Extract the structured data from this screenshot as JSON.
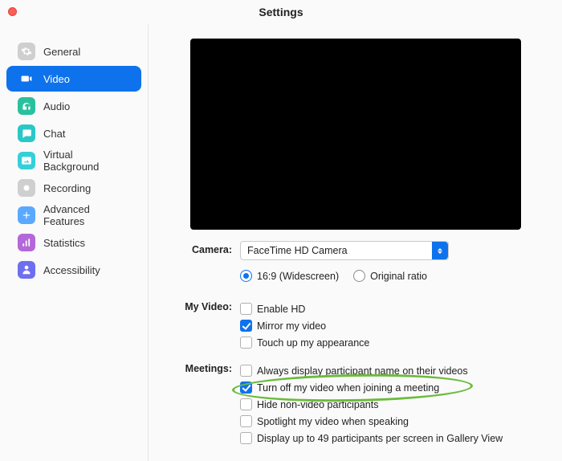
{
  "window": {
    "title": "Settings"
  },
  "sidebar": {
    "items": [
      {
        "label": "General",
        "icon": "gear",
        "color": "#cfcfcf"
      },
      {
        "label": "Video",
        "icon": "video",
        "color": "#0e72ed",
        "active": true
      },
      {
        "label": "Audio",
        "icon": "headphones",
        "color": "#29c19d"
      },
      {
        "label": "Chat",
        "icon": "chat",
        "color": "#2ac7c7"
      },
      {
        "label": "Virtual Background",
        "icon": "image",
        "color": "#33d0da"
      },
      {
        "label": "Recording",
        "icon": "record",
        "color": "#cfcfcf"
      },
      {
        "label": "Advanced Features",
        "icon": "plus",
        "color": "#5aa9ff"
      },
      {
        "label": "Statistics",
        "icon": "bars",
        "color": "#b367d8"
      },
      {
        "label": "Accessibility",
        "icon": "person",
        "color": "#6e6ef0"
      }
    ]
  },
  "camera": {
    "label": "Camera:",
    "selected": "FaceTime HD Camera",
    "aspect": {
      "wide": "16:9 (Widescreen)",
      "orig": "Original ratio",
      "value": "wide"
    }
  },
  "my_video": {
    "label": "My Video:",
    "enable_hd": {
      "label": "Enable HD",
      "on": false
    },
    "mirror": {
      "label": "Mirror my video",
      "on": true
    },
    "touch_up": {
      "label": "Touch up my appearance",
      "on": false
    }
  },
  "meetings": {
    "label": "Meetings:",
    "show_name": {
      "label": "Always display participant name on their videos",
      "on": false
    },
    "off_on_join": {
      "label": "Turn off my video when joining a meeting",
      "on": true
    },
    "hide_nonvid": {
      "label": "Hide non-video participants",
      "on": false
    },
    "spotlight": {
      "label": "Spotlight my video when speaking",
      "on": false
    },
    "gallery49": {
      "label": "Display up to 49 participants per screen in Gallery View",
      "on": false
    }
  },
  "annotation": {
    "circled_key": "meetings.off_on_join"
  }
}
